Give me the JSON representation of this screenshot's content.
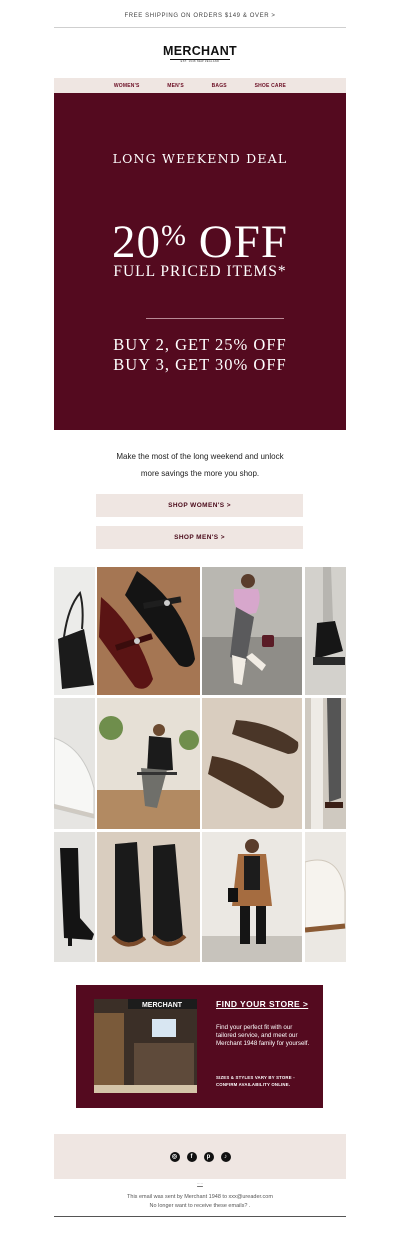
{
  "topbar": {
    "shipping": "FREE SHIPPING ON ORDERS $149 & OVER >"
  },
  "brand": {
    "name": "MERCHANT",
    "tagline": "EST. 1948 NEW ZEALAND"
  },
  "nav": {
    "items": [
      "WOMEN'S",
      "MEN'S",
      "BAGS",
      "SHOE CARE"
    ]
  },
  "hero": {
    "kicker": "LONG WEEKEND DEAL",
    "discount_number": "20",
    "discount_percent": "%",
    "discount_word": " OFF",
    "subtitle": "FULL PRICED ITEMS*",
    "offer1": "BUY 2, GET 25% OFF",
    "offer2": "BUY 3, GET 30% OFF",
    "background": "#540a1f"
  },
  "intro": {
    "line1": "Make the most of the long weekend and unlock",
    "line2": "more savings the more you shop."
  },
  "buttons": {
    "womens": "SHOP WOMEN'S >",
    "mens": "SHOP MEN'S >"
  },
  "store": {
    "title": "FIND YOUR STORE >",
    "body": "Find your perfect fit with our tailored service, and meet our Merchant 1948 family for yourself.",
    "note": "SIZES & STYLES VARY BY STORE - CONFIRM AVAILABILITY ONLINE.",
    "sign": "MERCHANT"
  },
  "social": {
    "icons": [
      "instagram-icon",
      "facebook-icon",
      "pinterest-icon",
      "tiktok-icon"
    ]
  },
  "footer": {
    "line1": "This email was sent by Merchant 1948 to xxx@ureader.com",
    "line2": "No longer want to receive these emails? ."
  },
  "colors": {
    "accent": "#540a1f",
    "nav_text": "#6b0e24",
    "beige": "#efe6e2"
  }
}
